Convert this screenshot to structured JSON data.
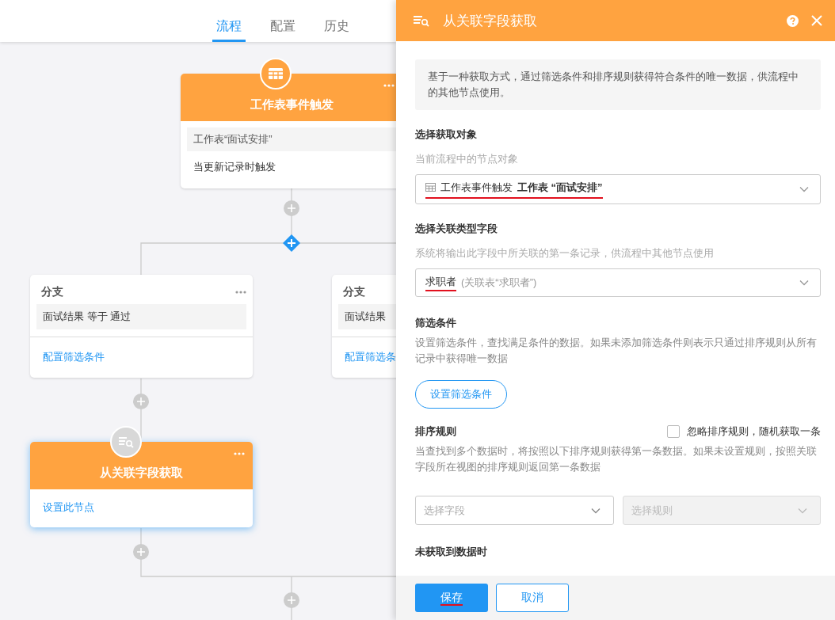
{
  "tabs": [
    {
      "label": "流程",
      "selected": true
    },
    {
      "label": "配置",
      "selected": false
    },
    {
      "label": "历史",
      "selected": false
    }
  ],
  "canvas": {
    "nodes": [
      {
        "kind": "trigger",
        "title": "工作表事件触发",
        "selected": false,
        "rows": [
          {
            "kind": "target",
            "text": "工作表“面试安排”"
          },
          {
            "kind": "event",
            "text": "当更新记录时触发"
          }
        ]
      },
      {
        "kind": "branch",
        "title": "分支",
        "condition": "面试结果 等于 通过",
        "link": "配置筛选条件"
      },
      {
        "kind": "branch",
        "title": "分支",
        "condition": "面试结果",
        "link": "配置筛选条"
      },
      {
        "kind": "fetch",
        "title": "从关联字段获取",
        "selected": true,
        "link": "设置此节点"
      }
    ]
  },
  "panel": {
    "title": "从关联字段获取",
    "description": "基于一种获取方式，通过筛选条件和排序规则获得符合条件的唯一数据，供流程中的其他节点使用。",
    "object_section": {
      "heading": "选择获取对象",
      "hint": "当前流程中的节点对象",
      "select": {
        "node_name": "工作表事件触发",
        "target": "工作表 “面试安排”",
        "underlined": true
      }
    },
    "field_section": {
      "heading": "选择关联类型字段",
      "hint": "系统将输出此字段中所关联的第一条记录，供流程中其他节点使用",
      "select": {
        "value": "求职者",
        "detail": "(关联表“求职者”)",
        "underlined": true
      }
    },
    "filter_section": {
      "heading": "筛选条件",
      "text": "设置筛选条件，查找满足条件的数据。如果未添加筛选条件则表示只通过排序规则从所有记录中获得唯一数据",
      "button": "设置筛选条件"
    },
    "sort_section": {
      "heading": "排序规则",
      "checkbox": {
        "label": "忽略排序规则，随机获取一条",
        "checked": false
      },
      "text": "当查找到多个数据时，将按照以下排序规则获得第一条数据。如果未设置规则，按照关联字段所在视图的排序规则返回第一条数据",
      "selects": [
        {
          "placeholder": "选择字段",
          "disabled": false
        },
        {
          "placeholder": "选择规则",
          "disabled": true
        }
      ]
    },
    "empty_section": {
      "heading": "未获取到数据时"
    },
    "buttons": [
      {
        "label": "保存",
        "kind": "primary",
        "underlined": true
      },
      {
        "label": "取消",
        "kind": "secondary",
        "underlined": false
      }
    ]
  }
}
